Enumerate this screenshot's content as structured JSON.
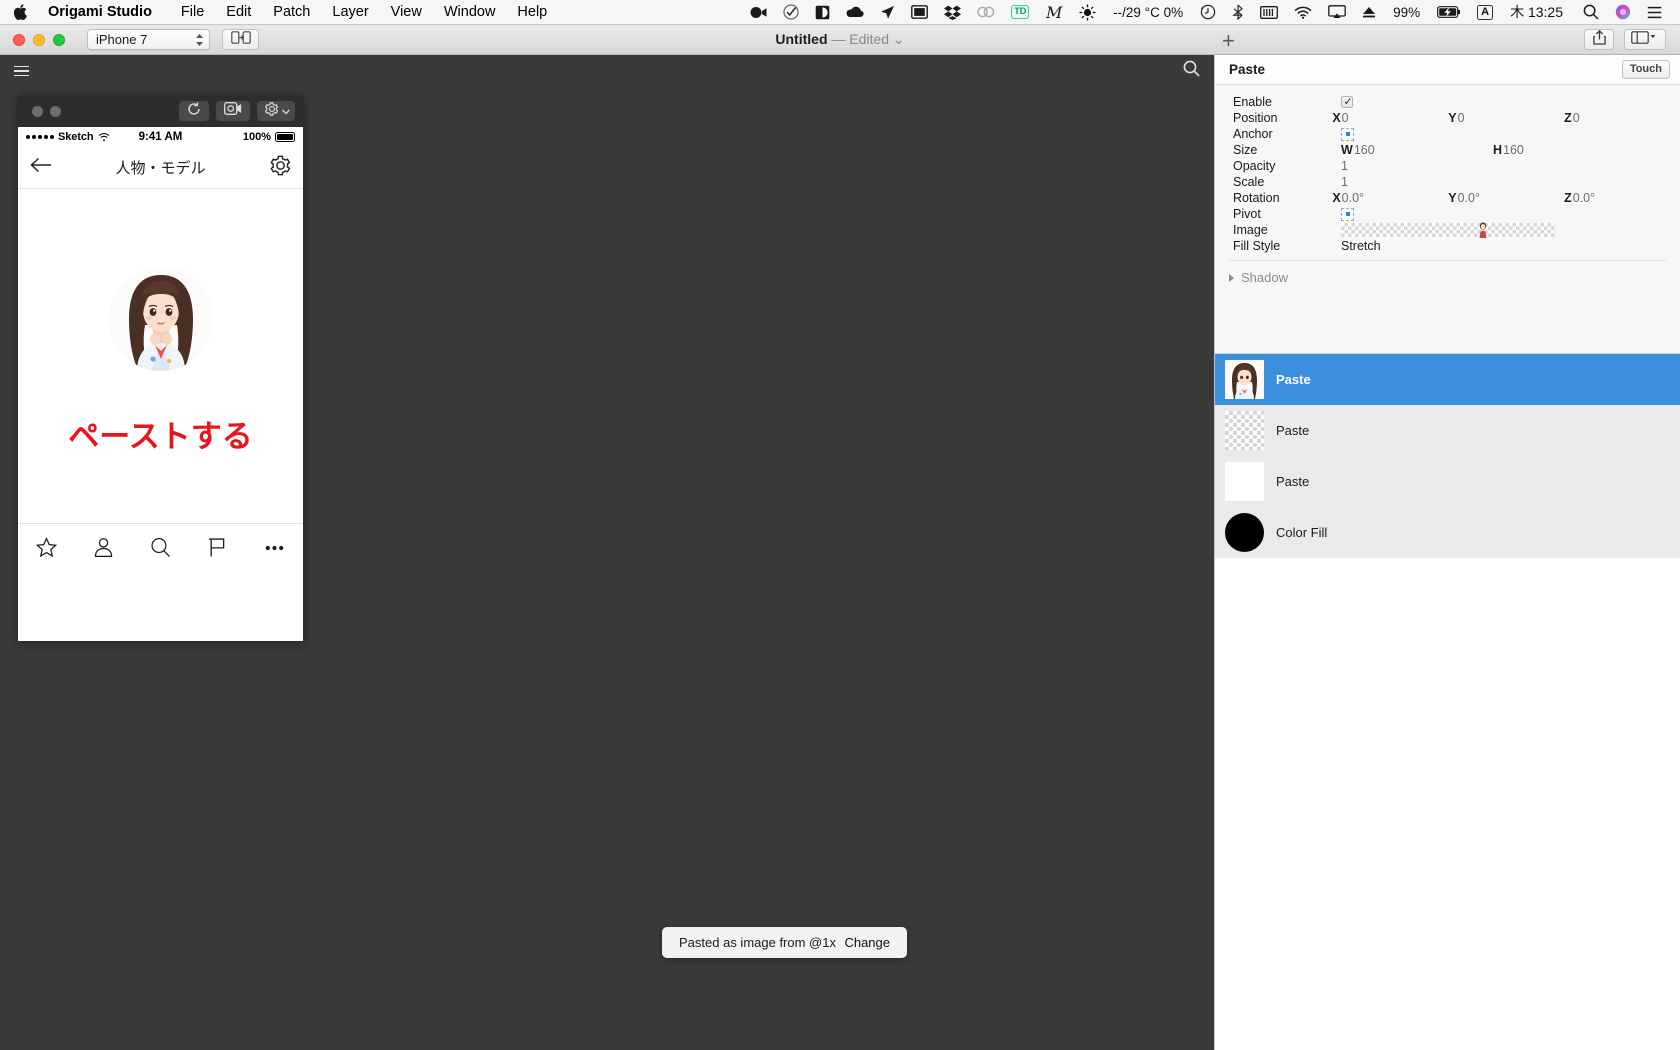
{
  "menubar": {
    "apple_icon": "apple-logo",
    "app_name": "Origami Studio",
    "items": [
      "File",
      "Edit",
      "Patch",
      "Layer",
      "View",
      "Window",
      "Help"
    ],
    "status_icons": [
      "video-camera-icon",
      "checkmark-circle-icon",
      "contrast-icon",
      "cloud-icon",
      "location-arrow-icon",
      "display-icon",
      "dropbox-icon",
      "creative-cloud-icon"
    ],
    "td_badge": "TD",
    "script_icon": "m-script-icon",
    "brightness_icon": "sun-icon",
    "weather": "--/29 °C 0%",
    "time_machine_icon": "clock-history-icon",
    "bluetooth_icon": "bluetooth-icon",
    "storage_icon": "storage-icon",
    "wifi_icon": "wifi-icon",
    "airplay_icon": "airplay-icon",
    "eject_icon": "eject-icon",
    "battery_percent": "99%",
    "battery_icon": "battery-charging-icon",
    "input_badge": "A",
    "clock": "木 13:25",
    "spotlight_icon": "search-icon",
    "siri_icon": "siri-icon",
    "notification_icon": "notification-center-icon"
  },
  "titlebar": {
    "device": "iPhone 7",
    "mirror_icon": "mirror-device-icon",
    "title_main": "Untitled",
    "title_sep": "—",
    "title_status": "Edited",
    "title_chevron": "chevron-down-icon",
    "add_icon": "plus-icon",
    "share_icon": "share-icon",
    "layout_icon": "layout-panels-icon"
  },
  "canvas_toolbar": {
    "menu_icon": "hamburger-menu-icon",
    "search_icon": "search-icon"
  },
  "phone": {
    "chrome": {
      "dot_left": "window-dot",
      "dot_right": "window-dot",
      "refresh_icon": "refresh-icon",
      "record_icon": "record-video-icon",
      "settings_icon": "gear-icon",
      "settings_chevron": "chevron-down-icon"
    },
    "status_bar": {
      "carrier": "Sketch",
      "wifi_icon": "wifi-icon",
      "time": "9:41 AM",
      "battery_text": "100%",
      "battery_icon": "battery-full-icon"
    },
    "nav": {
      "back_icon": "back-arrow-icon",
      "title": "人物・モデル",
      "settings_icon": "gear-icon"
    },
    "content": {
      "avatar": "model-portrait-avatar",
      "headline": "ペーストする"
    },
    "tabbar": [
      {
        "icon": "star-icon",
        "name": "tab-favorites"
      },
      {
        "icon": "person-icon",
        "name": "tab-profile"
      },
      {
        "icon": "search-icon",
        "name": "tab-search"
      },
      {
        "icon": "flag-icon",
        "name": "tab-flag"
      },
      {
        "icon": "more-dots-icon",
        "name": "tab-more"
      }
    ]
  },
  "inspector": {
    "title": "Paste",
    "touch_label": "Touch",
    "properties": [
      {
        "label": "Enable",
        "type": "checkbox",
        "checked": true
      },
      {
        "label": "Position",
        "type": "xyz",
        "x_axis": "X",
        "x": "0",
        "y_axis": "Y",
        "y": "0",
        "z_axis": "Z",
        "z": "0"
      },
      {
        "label": "Anchor",
        "type": "anchor"
      },
      {
        "label": "Size",
        "type": "wh",
        "w_axis": "W",
        "w": "160",
        "h_axis": "H",
        "h": "160"
      },
      {
        "label": "Opacity",
        "type": "value",
        "value": "1"
      },
      {
        "label": "Scale",
        "type": "value",
        "value": "1"
      },
      {
        "label": "Rotation",
        "type": "xyz",
        "x_axis": "X",
        "x": "0.0°",
        "y_axis": "Y",
        "y": "0.0°",
        "z_axis": "Z",
        "z": "0.0°"
      },
      {
        "label": "Pivot",
        "type": "anchor"
      },
      {
        "label": "Image",
        "type": "image"
      },
      {
        "label": "Fill Style",
        "type": "value",
        "value": "Stretch"
      }
    ],
    "shadow": {
      "label": "Shadow",
      "disclosure_icon": "disclosure-triangle-icon"
    },
    "layers": [
      {
        "name": "Paste",
        "thumb": "portrait-thumbnail",
        "selected": true
      },
      {
        "name": "Paste",
        "thumb": "transparent-thumbnail",
        "selected": false
      },
      {
        "name": "Paste",
        "thumb": "white-thumbnail",
        "selected": false
      },
      {
        "name": "Color Fill",
        "thumb": "black-circle-thumbnail",
        "selected": false
      }
    ]
  },
  "toast": {
    "message": "Pasted as image from @1x",
    "action": "Change"
  },
  "colors": {
    "accent_blue": "#3b8fdd",
    "headline_red": "#e8141e",
    "canvas_dark": "#3a3a3a",
    "panel_bg": "#f7f7f7"
  }
}
